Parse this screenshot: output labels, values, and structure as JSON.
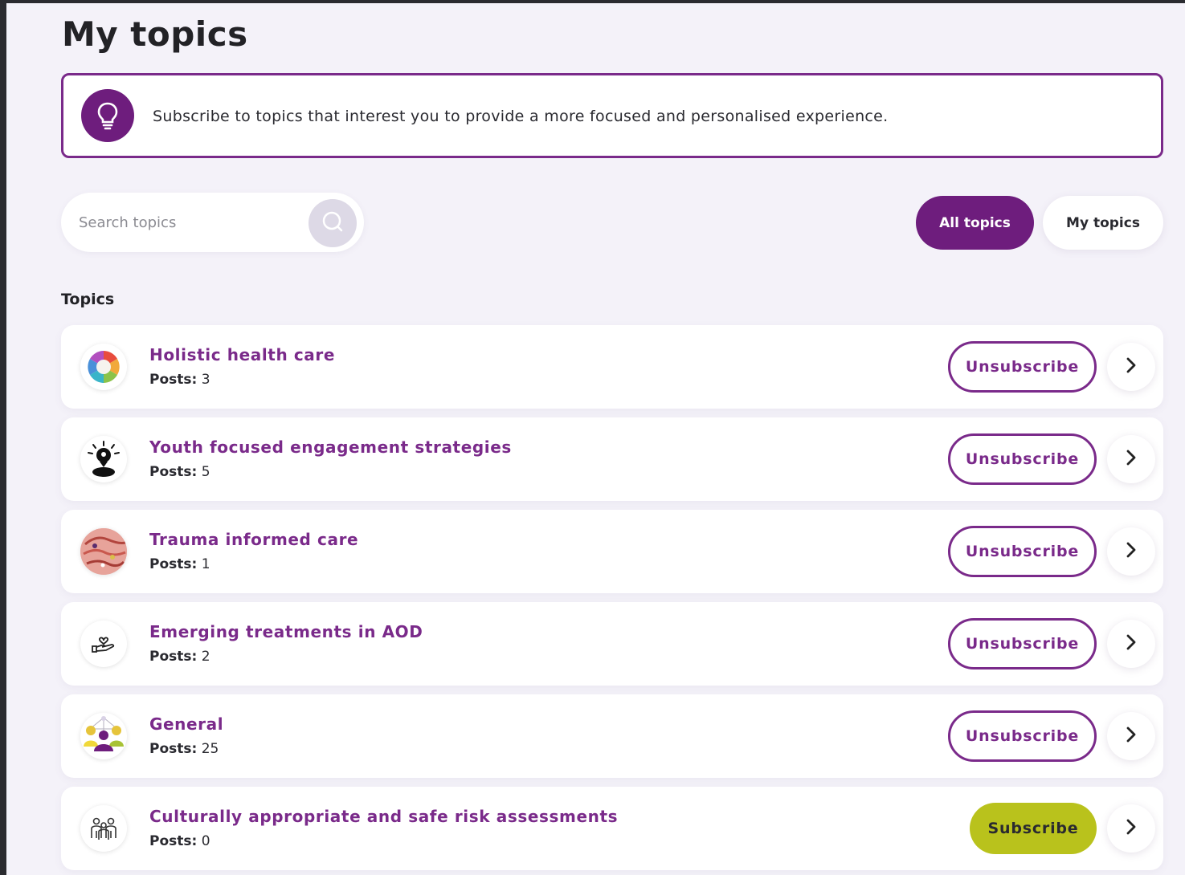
{
  "header": {
    "title": "My topics"
  },
  "banner": {
    "icon": "lightbulb-icon",
    "text": "Subscribe to topics that interest you to provide a more focused and personalised experience."
  },
  "search": {
    "placeholder": "Search topics",
    "value": "",
    "icon": "search-icon"
  },
  "tabs": [
    {
      "label": "All topics",
      "active": true
    },
    {
      "label": "My topics",
      "active": false
    }
  ],
  "section_label": "Topics",
  "posts_label": "Posts:",
  "topics": [
    {
      "title": "Holistic health care",
      "posts": "3",
      "action": "Unsubscribe"
    },
    {
      "title": "Youth focused engagement strategies",
      "posts": "5",
      "action": "Unsubscribe"
    },
    {
      "title": "Trauma informed care",
      "posts": "1",
      "action": "Unsubscribe"
    },
    {
      "title": "Emerging treatments in AOD",
      "posts": "2",
      "action": "Unsubscribe"
    },
    {
      "title": "General",
      "posts": "25",
      "action": "Unsubscribe"
    },
    {
      "title": "Culturally appropriate and safe risk assessments",
      "posts": "0",
      "action": "Subscribe"
    }
  ],
  "colors": {
    "primary": "#6e1d7d",
    "accent": "#b9c21c",
    "background": "#f4f2f9"
  }
}
